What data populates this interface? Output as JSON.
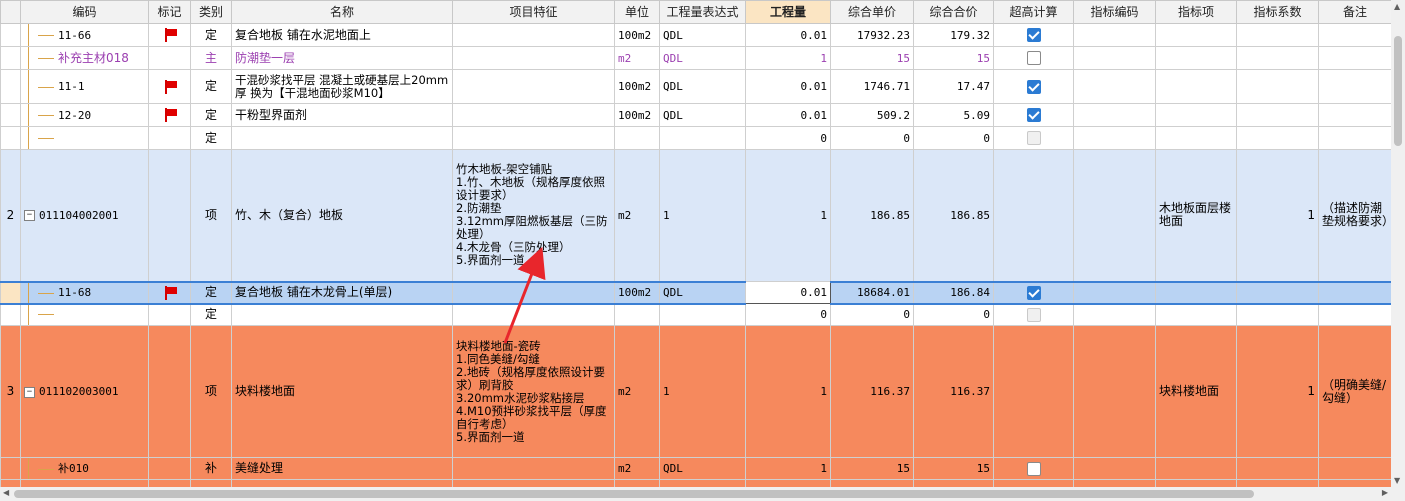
{
  "columns": [
    "编码",
    "标记",
    "类别",
    "名称",
    "项目特征",
    "单位",
    "工程量表达式",
    "工程量",
    "综合单价",
    "综合合价",
    "超高计算",
    "指标编码",
    "指标项",
    "指标系数",
    "备注"
  ],
  "rows": {
    "r1": {
      "code": "11-66",
      "type": "定",
      "name": "复合地板 铺在水泥地面上",
      "unit": "100m2",
      "expr": "QDL",
      "qty": "0.01",
      "price": "17932.23",
      "total": "179.32"
    },
    "r2": {
      "code": "补充主材018",
      "type": "主",
      "name": "防潮垫一层",
      "unit": "m2",
      "expr": "QDL",
      "qty": "1",
      "price": "15",
      "total": "15"
    },
    "r3": {
      "code": "11-1",
      "type": "定",
      "name": "干混砂浆找平层 混凝土或硬基层上20mm 厚  换为【干混地面砂浆M10】",
      "unit": "100m2",
      "expr": "QDL",
      "qty": "0.01",
      "price": "1746.71",
      "total": "17.47"
    },
    "r4": {
      "code": "12-20",
      "type": "定",
      "name": "干粉型界面剂",
      "unit": "100m2",
      "expr": "QDL",
      "qty": "0.01",
      "price": "509.2",
      "total": "5.09"
    },
    "r5": {
      "type": "定",
      "qty": "0",
      "price": "0",
      "total": "0"
    },
    "r6": {
      "seq": "2",
      "code": "011104002001",
      "type": "项",
      "name": "竹、木（复合）地板",
      "feature": "竹木地板-架空铺贴\n1.竹、木地板（规格厚度依照设计要求）\n2.防潮垫\n3.12mm厚阻燃板基层（三防处理）\n4.木龙骨（三防处理）\n5.界面剂一道",
      "unit": "m2",
      "expr": "1",
      "qty": "1",
      "price": "186.85",
      "total": "186.85",
      "index_item": "木地板面层楼地面",
      "index_coef": "1",
      "remark": "（描述防潮垫规格要求）"
    },
    "r7": {
      "code": "11-68",
      "type": "定",
      "name": "复合地板 铺在木龙骨上(单层)",
      "unit": "100m2",
      "expr": "QDL",
      "qty": "0.01",
      "price": "18684.01",
      "total": "186.84"
    },
    "r8": {
      "type": "定",
      "qty": "0",
      "price": "0",
      "total": "0"
    },
    "r9": {
      "seq": "3",
      "code": "011102003001",
      "type": "项",
      "name": "块料楼地面",
      "feature": "块料楼地面-瓷砖\n1.同色美缝/勾缝\n2.地砖（规格厚度依照设计要求）刷背胶\n3.20mm水泥砂浆粘接层\n4.M10预拌砂浆找平层（厚度自行考虑）\n5.界面剂一道",
      "unit": "m2",
      "expr": "1",
      "qty": "1",
      "price": "116.37",
      "total": "116.37",
      "index_item": "块料楼地面",
      "index_coef": "1",
      "remark": "（明确美缝/勾缝）"
    },
    "r10": {
      "code": "补010",
      "type": "补",
      "name": "美缝处理",
      "unit": "m2",
      "expr": "QDL",
      "qty": "1",
      "price": "15",
      "total": "15"
    }
  },
  "colors": {
    "header_bg": "#f2f2f2",
    "active_header_bg": "#fbe5c3",
    "item_row_blue": "#dbe7f8",
    "selected_row": "#b9d3f3",
    "item_row_orange": "#f6895d",
    "material_text": "#9b3fb0",
    "flag_red": "#e00000",
    "checkbox_blue": "#2b7bd3",
    "arrow_red": "#e8262c"
  },
  "icons": {
    "flag": "red-flag-icon",
    "checked": "checkbox-checked-icon",
    "unchecked": "checkbox-unchecked-icon",
    "collapse": "minus-expander-icon"
  }
}
